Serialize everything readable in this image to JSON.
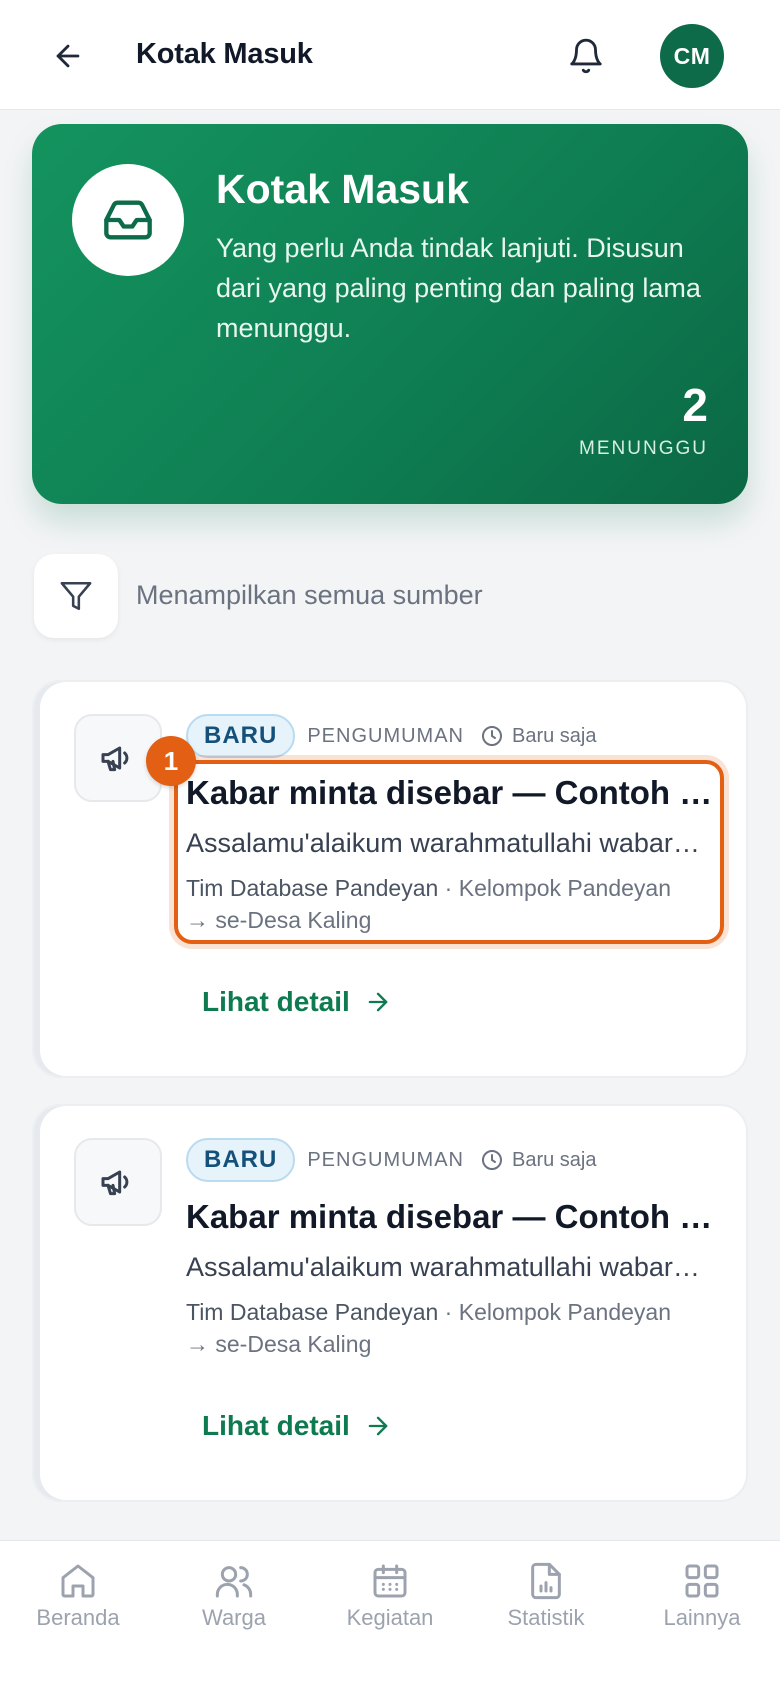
{
  "header": {
    "title": "Kotak Masuk",
    "avatar_initials": "CM"
  },
  "hero": {
    "title": "Kotak Masuk",
    "description": "Yang perlu Anda tindak lanjuti. Disusun dari yang paling penting dan paling lama menunggu.",
    "count": "2",
    "count_label": "MENUNGGU"
  },
  "filter": {
    "label": "Menampilkan semua sumber"
  },
  "highlight_number": "1",
  "items": [
    {
      "badge": "BARU",
      "category": "PENGUMUMAN",
      "time": "Baru saja",
      "title": "Kabar minta disebar — Contoh Materi Pengumuman",
      "excerpt": "Assalamu'alaikum warahmatullahi wabarakatuh",
      "author": "Tim Database Pandeyan",
      "separator": " · ",
      "group": "Kelompok Pandeyan",
      "target": "→ se-Desa Kaling",
      "detail_label": "Lihat detail"
    },
    {
      "badge": "BARU",
      "category": "PENGUMUMAN",
      "time": "Baru saja",
      "title": "Kabar minta disebar — Contoh Materi Pengumuman",
      "excerpt": "Assalamu'alaikum warahmatullahi wabarakatuh",
      "author": "Tim Database Pandeyan",
      "separator": " · ",
      "group": "Kelompok Pandeyan",
      "target": "→ se-Desa Kaling",
      "detail_label": "Lihat detail"
    }
  ],
  "nav": [
    {
      "label": "Beranda",
      "icon": "home-icon"
    },
    {
      "label": "Warga",
      "icon": "users-icon"
    },
    {
      "label": "Kegiatan",
      "icon": "calendar-icon"
    },
    {
      "label": "Statistik",
      "icon": "chart-file-icon"
    },
    {
      "label": "Lainnya",
      "icon": "grid-icon"
    }
  ],
  "colors": {
    "primary": "#0e7a4f",
    "hero_start": "#14935f",
    "hero_end": "#0b6844",
    "highlight": "#e25f14",
    "badge_bg": "#e7f3fb"
  }
}
